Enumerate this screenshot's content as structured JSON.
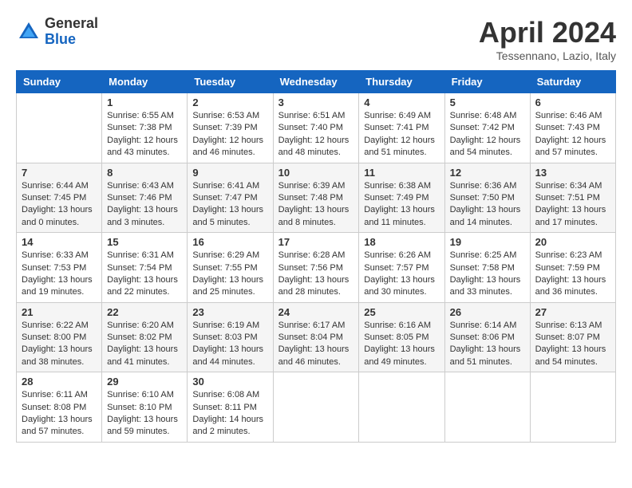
{
  "logo": {
    "general": "General",
    "blue": "Blue"
  },
  "title": "April 2024",
  "location": "Tessennano, Lazio, Italy",
  "days_header": [
    "Sunday",
    "Monday",
    "Tuesday",
    "Wednesday",
    "Thursday",
    "Friday",
    "Saturday"
  ],
  "weeks": [
    [
      {
        "day": "",
        "sunrise": "",
        "sunset": "",
        "daylight": ""
      },
      {
        "day": "1",
        "sunrise": "Sunrise: 6:55 AM",
        "sunset": "Sunset: 7:38 PM",
        "daylight": "Daylight: 12 hours and 43 minutes."
      },
      {
        "day": "2",
        "sunrise": "Sunrise: 6:53 AM",
        "sunset": "Sunset: 7:39 PM",
        "daylight": "Daylight: 12 hours and 46 minutes."
      },
      {
        "day": "3",
        "sunrise": "Sunrise: 6:51 AM",
        "sunset": "Sunset: 7:40 PM",
        "daylight": "Daylight: 12 hours and 48 minutes."
      },
      {
        "day": "4",
        "sunrise": "Sunrise: 6:49 AM",
        "sunset": "Sunset: 7:41 PM",
        "daylight": "Daylight: 12 hours and 51 minutes."
      },
      {
        "day": "5",
        "sunrise": "Sunrise: 6:48 AM",
        "sunset": "Sunset: 7:42 PM",
        "daylight": "Daylight: 12 hours and 54 minutes."
      },
      {
        "day": "6",
        "sunrise": "Sunrise: 6:46 AM",
        "sunset": "Sunset: 7:43 PM",
        "daylight": "Daylight: 12 hours and 57 minutes."
      }
    ],
    [
      {
        "day": "7",
        "sunrise": "Sunrise: 6:44 AM",
        "sunset": "Sunset: 7:45 PM",
        "daylight": "Daylight: 13 hours and 0 minutes."
      },
      {
        "day": "8",
        "sunrise": "Sunrise: 6:43 AM",
        "sunset": "Sunset: 7:46 PM",
        "daylight": "Daylight: 13 hours and 3 minutes."
      },
      {
        "day": "9",
        "sunrise": "Sunrise: 6:41 AM",
        "sunset": "Sunset: 7:47 PM",
        "daylight": "Daylight: 13 hours and 5 minutes."
      },
      {
        "day": "10",
        "sunrise": "Sunrise: 6:39 AM",
        "sunset": "Sunset: 7:48 PM",
        "daylight": "Daylight: 13 hours and 8 minutes."
      },
      {
        "day": "11",
        "sunrise": "Sunrise: 6:38 AM",
        "sunset": "Sunset: 7:49 PM",
        "daylight": "Daylight: 13 hours and 11 minutes."
      },
      {
        "day": "12",
        "sunrise": "Sunrise: 6:36 AM",
        "sunset": "Sunset: 7:50 PM",
        "daylight": "Daylight: 13 hours and 14 minutes."
      },
      {
        "day": "13",
        "sunrise": "Sunrise: 6:34 AM",
        "sunset": "Sunset: 7:51 PM",
        "daylight": "Daylight: 13 hours and 17 minutes."
      }
    ],
    [
      {
        "day": "14",
        "sunrise": "Sunrise: 6:33 AM",
        "sunset": "Sunset: 7:53 PM",
        "daylight": "Daylight: 13 hours and 19 minutes."
      },
      {
        "day": "15",
        "sunrise": "Sunrise: 6:31 AM",
        "sunset": "Sunset: 7:54 PM",
        "daylight": "Daylight: 13 hours and 22 minutes."
      },
      {
        "day": "16",
        "sunrise": "Sunrise: 6:29 AM",
        "sunset": "Sunset: 7:55 PM",
        "daylight": "Daylight: 13 hours and 25 minutes."
      },
      {
        "day": "17",
        "sunrise": "Sunrise: 6:28 AM",
        "sunset": "Sunset: 7:56 PM",
        "daylight": "Daylight: 13 hours and 28 minutes."
      },
      {
        "day": "18",
        "sunrise": "Sunrise: 6:26 AM",
        "sunset": "Sunset: 7:57 PM",
        "daylight": "Daylight: 13 hours and 30 minutes."
      },
      {
        "day": "19",
        "sunrise": "Sunrise: 6:25 AM",
        "sunset": "Sunset: 7:58 PM",
        "daylight": "Daylight: 13 hours and 33 minutes."
      },
      {
        "day": "20",
        "sunrise": "Sunrise: 6:23 AM",
        "sunset": "Sunset: 7:59 PM",
        "daylight": "Daylight: 13 hours and 36 minutes."
      }
    ],
    [
      {
        "day": "21",
        "sunrise": "Sunrise: 6:22 AM",
        "sunset": "Sunset: 8:00 PM",
        "daylight": "Daylight: 13 hours and 38 minutes."
      },
      {
        "day": "22",
        "sunrise": "Sunrise: 6:20 AM",
        "sunset": "Sunset: 8:02 PM",
        "daylight": "Daylight: 13 hours and 41 minutes."
      },
      {
        "day": "23",
        "sunrise": "Sunrise: 6:19 AM",
        "sunset": "Sunset: 8:03 PM",
        "daylight": "Daylight: 13 hours and 44 minutes."
      },
      {
        "day": "24",
        "sunrise": "Sunrise: 6:17 AM",
        "sunset": "Sunset: 8:04 PM",
        "daylight": "Daylight: 13 hours and 46 minutes."
      },
      {
        "day": "25",
        "sunrise": "Sunrise: 6:16 AM",
        "sunset": "Sunset: 8:05 PM",
        "daylight": "Daylight: 13 hours and 49 minutes."
      },
      {
        "day": "26",
        "sunrise": "Sunrise: 6:14 AM",
        "sunset": "Sunset: 8:06 PM",
        "daylight": "Daylight: 13 hours and 51 minutes."
      },
      {
        "day": "27",
        "sunrise": "Sunrise: 6:13 AM",
        "sunset": "Sunset: 8:07 PM",
        "daylight": "Daylight: 13 hours and 54 minutes."
      }
    ],
    [
      {
        "day": "28",
        "sunrise": "Sunrise: 6:11 AM",
        "sunset": "Sunset: 8:08 PM",
        "daylight": "Daylight: 13 hours and 57 minutes."
      },
      {
        "day": "29",
        "sunrise": "Sunrise: 6:10 AM",
        "sunset": "Sunset: 8:10 PM",
        "daylight": "Daylight: 13 hours and 59 minutes."
      },
      {
        "day": "30",
        "sunrise": "Sunrise: 6:08 AM",
        "sunset": "Sunset: 8:11 PM",
        "daylight": "Daylight: 14 hours and 2 minutes."
      },
      {
        "day": "",
        "sunrise": "",
        "sunset": "",
        "daylight": ""
      },
      {
        "day": "",
        "sunrise": "",
        "sunset": "",
        "daylight": ""
      },
      {
        "day": "",
        "sunrise": "",
        "sunset": "",
        "daylight": ""
      },
      {
        "day": "",
        "sunrise": "",
        "sunset": "",
        "daylight": ""
      }
    ]
  ]
}
